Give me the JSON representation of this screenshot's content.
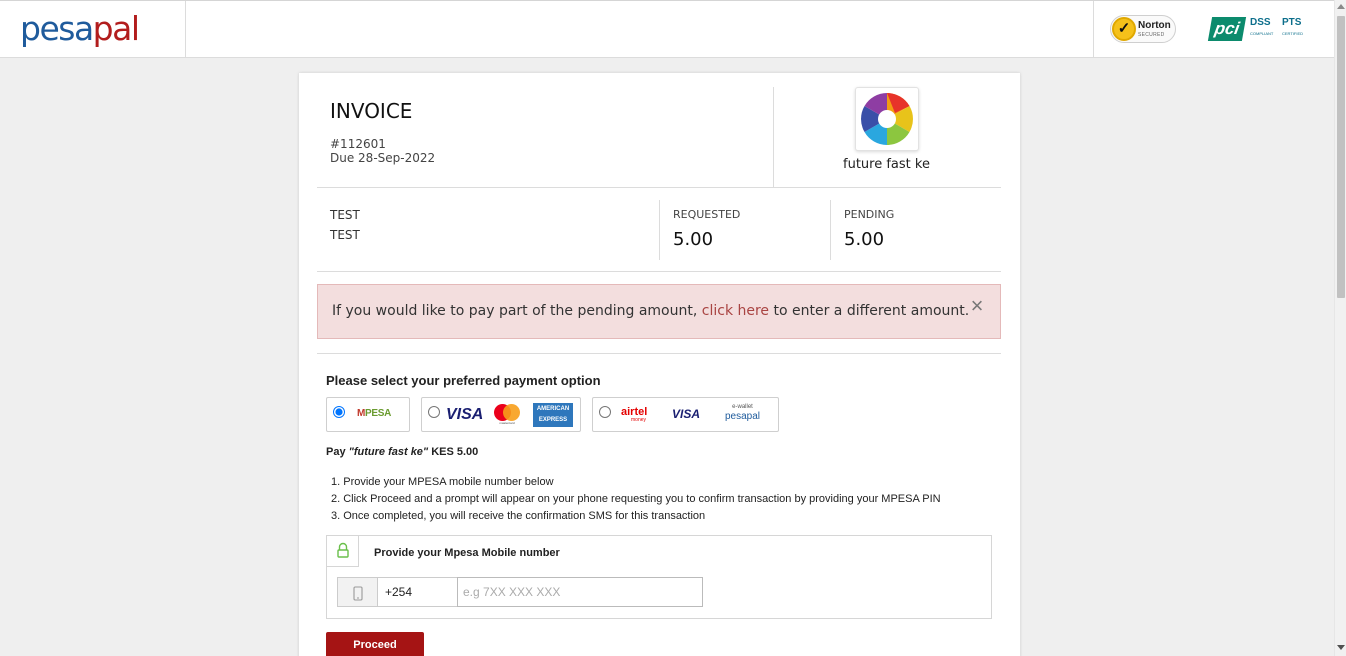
{
  "header": {
    "logo_part1": "pesa",
    "logo_part2": "pal",
    "norton_title": "Norton",
    "norton_sub": "SECURED",
    "pci_mark": "pci",
    "pci_dss": "DSS",
    "pci_pts": "PTS",
    "pci_dss_sub": "COMPLIANT",
    "pci_pts_sub": "CERTIFIED"
  },
  "invoice": {
    "title": "INVOICE",
    "number": "#112601",
    "due": "Due 28-Sep-2022",
    "merchant_name": "future fast ke",
    "items": [
      "TEST",
      "TEST"
    ],
    "requested_label": "REQUESTED",
    "requested_value": "5.00",
    "pending_label": "PENDING",
    "pending_value": "5.00"
  },
  "alert": {
    "text_before": "If you would like to pay part of the pending amount, ",
    "link": "click here",
    "text_after": " to enter a different amount.",
    "close": "×"
  },
  "payment": {
    "title": "Please select your preferred payment option",
    "options": [
      {
        "id": "mpesa",
        "selected": true
      },
      {
        "id": "cards",
        "selected": false
      },
      {
        "id": "wallets",
        "selected": false
      }
    ],
    "mpesa_m": "M",
    "mpesa_label": "PESA",
    "visa": "VISA",
    "mastercard": "mastercard",
    "amex_line1": "AMERICAN",
    "amex_line2": "EXPRESS",
    "airtel": "airtel",
    "airtel_sub": "money",
    "visa2": "VISA",
    "ewallet_top": "e-wallet",
    "ewallet_brand": "pesapal",
    "pay_prefix": "Pay ",
    "pay_merchant": "\"future fast ke\"",
    "pay_amount": " KES 5.00",
    "steps": [
      "1. Provide your MPESA mobile number below",
      "2. Click Proceed and a prompt will appear on your phone requesting you to confirm transaction by providing your MPESA PIN",
      "3. Once completed, you will receive the confirmation SMS for this transaction"
    ],
    "mobile_box_title": "Provide your Mpesa Mobile number",
    "country_code": "+254",
    "number_placeholder": "e.g 7XX XXX XXX",
    "proceed": "Proceed"
  },
  "colors": {
    "brand_blue": "#1f5b9c",
    "brand_red": "#b21d1d",
    "proceed_bg": "#a51414",
    "alert_bg": "#f3dede",
    "alert_link": "#a94442"
  }
}
